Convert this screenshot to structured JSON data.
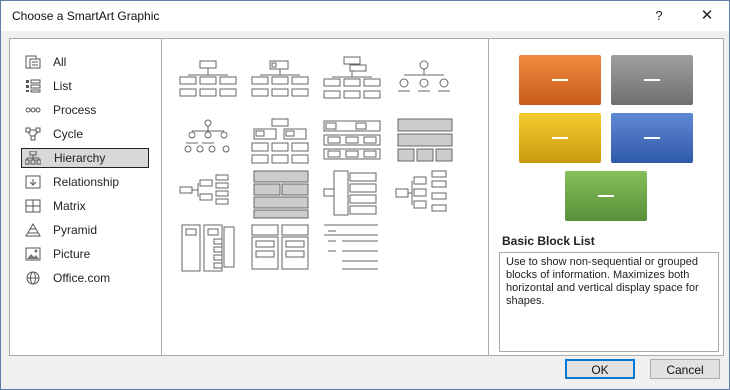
{
  "window": {
    "title": "Choose a SmartArt Graphic",
    "help_glyph": "?",
    "close_glyph": "✕"
  },
  "categories": [
    {
      "label": "All",
      "icon": "all-icon"
    },
    {
      "label": "List",
      "icon": "list-icon"
    },
    {
      "label": "Process",
      "icon": "process-icon"
    },
    {
      "label": "Cycle",
      "icon": "cycle-icon"
    },
    {
      "label": "Hierarchy",
      "icon": "hierarchy-icon",
      "selected": true
    },
    {
      "label": "Relationship",
      "icon": "relationship-icon"
    },
    {
      "label": "Matrix",
      "icon": "matrix-icon"
    },
    {
      "label": "Pyramid",
      "icon": "pyramid-icon"
    },
    {
      "label": "Picture",
      "icon": "picture-icon"
    },
    {
      "label": "Office.com",
      "icon": "globe-icon"
    }
  ],
  "gallery": {
    "layout_count": 15
  },
  "preview": {
    "title": "Basic Block List",
    "description": "Use to show non-sequential or grouped blocks of information. Maximizes both horizontal and vertical display space for shapes.",
    "block_colors": [
      "#e07028",
      "#8a8a8a",
      "#e8b820",
      "#4a74c4",
      "#70a848"
    ],
    "block_text": "—"
  },
  "buttons": {
    "ok": "OK",
    "cancel": "Cancel"
  }
}
